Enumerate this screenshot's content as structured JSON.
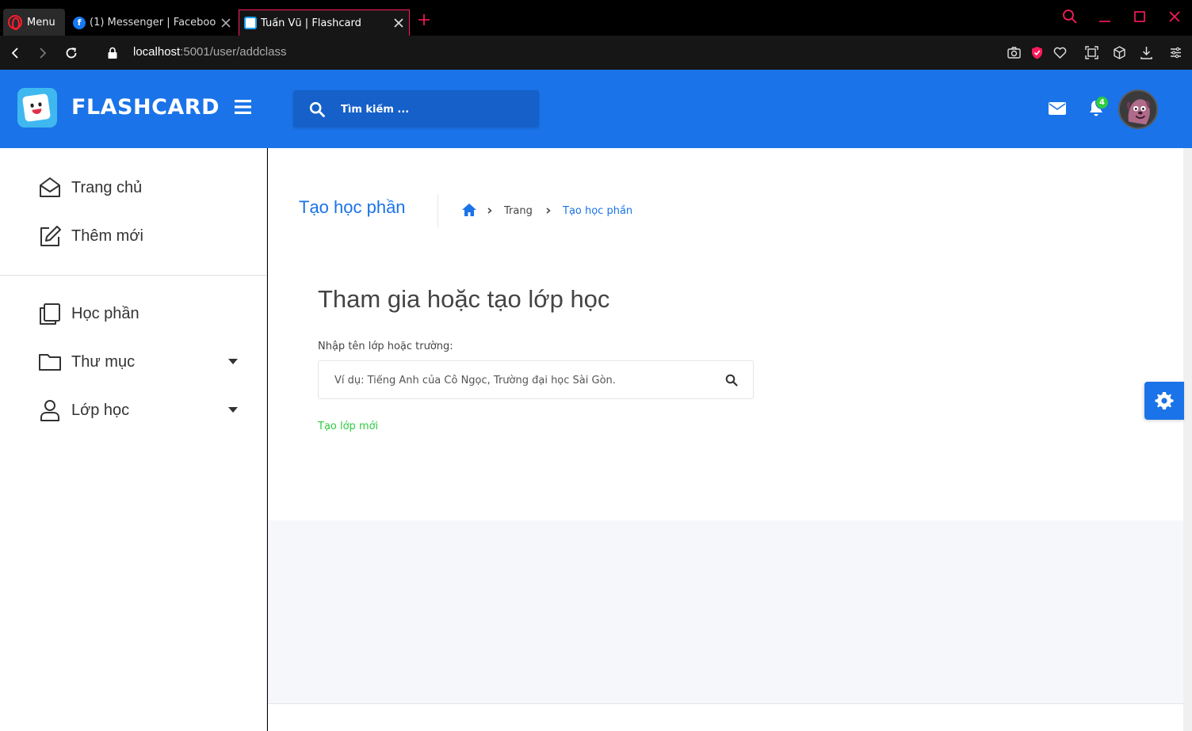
{
  "browser": {
    "menu_label": "Menu",
    "tabs": [
      {
        "title": "(1) Messenger | Facebook"
      },
      {
        "title": "Tuấn Vũ | Flashcard"
      }
    ],
    "url_host": "localhost",
    "url_rest": ":5001/user/addclass"
  },
  "header": {
    "brand": "FLASHCARD",
    "search_placeholder": "Tìm kiếm ...",
    "notification_count": "4"
  },
  "sidebar": {
    "items": [
      {
        "label": "Trang chủ",
        "icon": "envelope-open-icon"
      },
      {
        "label": "Thêm mới",
        "icon": "edit-icon"
      },
      {
        "label": "Học phần",
        "icon": "copy-icon"
      },
      {
        "label": "Thư mục",
        "icon": "folder-icon"
      },
      {
        "label": "Lớp học",
        "icon": "user-icon"
      }
    ]
  },
  "page": {
    "title": "Tạo học phần",
    "breadcrumb": [
      "Trang",
      "Tạo học phần"
    ],
    "section_title": "Tham gia hoặc tạo lớp học",
    "field_label": "Nhập tên lớp hoặc trường:",
    "field_placeholder": "Ví dụ: Tiếng Anh của Cô Ngọc, Trường đại học Sài Gòn.",
    "create_link": "Tạo lớp mới"
  },
  "colors": {
    "primary": "#1a73e8",
    "success": "#2ecc40",
    "browser_accent": "#ff1b2d"
  }
}
